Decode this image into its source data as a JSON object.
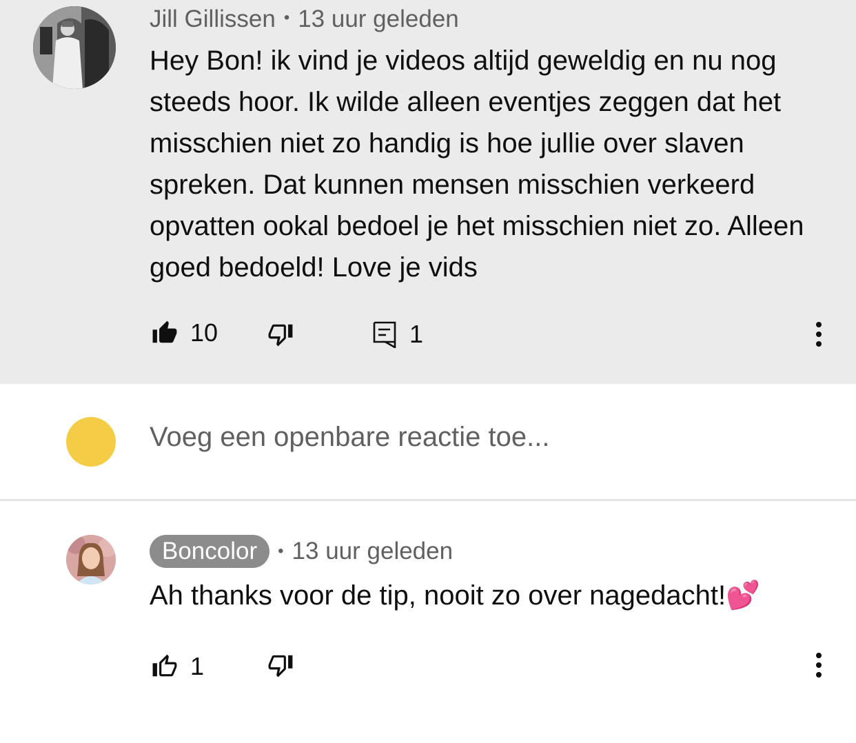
{
  "parent_comment": {
    "author": "Jill Gillissen",
    "separator": "•",
    "time": "13 uur geleden",
    "text": "Hey Bon! ik vind je videos altijd geweldig en nu nog steeds hoor. Ik wilde alleen eventjes zeggen dat het misschien niet zo handig is hoe jullie over slaven spreken. Dat kunnen mensen misschien verkeerd opvatten ookal bedoel je het misschien niet zo. Alleen goed bedoeld! Love je vids",
    "like_count": "10",
    "reply_count": "1",
    "liked": true,
    "background_color": "#ebebeb"
  },
  "reply_box": {
    "placeholder": "Voeg een openbare reactie toe...",
    "avatar_color": "#f5cc45"
  },
  "reply_comment": {
    "author": "Boncolor",
    "author_is_creator": true,
    "separator": "•",
    "time": "13 uur geleden",
    "text": "Ah thanks voor de tip, nooit zo over nagedacht!",
    "emoji": "💕",
    "like_count": "1"
  },
  "icons": {
    "like_filled": "thumb-up-filled-icon",
    "like_outline": "thumb-up-outline-icon",
    "dislike_outline": "thumb-down-outline-icon",
    "reply": "comment-reply-icon",
    "more": "more-vertical-icon"
  }
}
